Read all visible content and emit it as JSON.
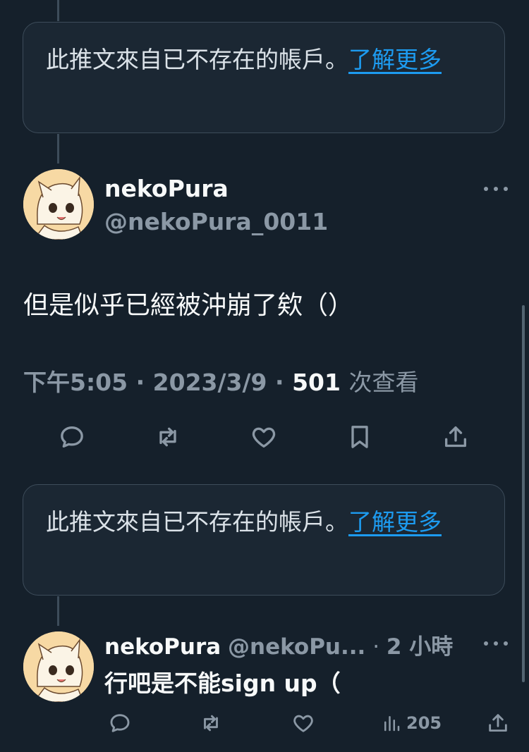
{
  "notice": {
    "text": "此推文來自已不存在的帳戶。",
    "link": "了解更多"
  },
  "main_tweet": {
    "display_name": "nekoPura",
    "handle": "@nekoPura_0011",
    "text": "但是似乎已經被沖崩了欸（）",
    "time": "下午5:05",
    "date": "2023/3/9",
    "views_count": "501",
    "views_label": "次查看",
    "separator": "·"
  },
  "notice2": {
    "text": "此推文來自已不存在的帳戶。",
    "link": "了解更多"
  },
  "reply": {
    "display_name": "nekoPura",
    "handle": "@nekoPu...",
    "separator": "·",
    "time": "2 小時",
    "text": "行吧是不能sign up（",
    "views": "205"
  },
  "icons": {
    "reply": "comment-icon",
    "retweet": "retweet-icon",
    "like": "heart-icon",
    "bookmark": "bookmark-icon",
    "share": "share-icon",
    "views": "analytics-icon",
    "more": "more-dots-icon"
  },
  "colors": {
    "background": "#15202b",
    "link": "#1d9bf0",
    "muted": "#8b98a5"
  }
}
